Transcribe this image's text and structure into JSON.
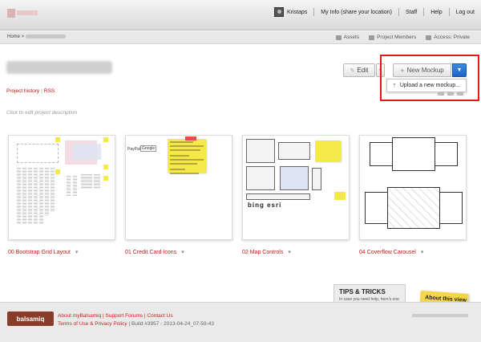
{
  "topbar": {
    "user": "Kristaps",
    "myinfo": "My Info (share your location)",
    "staff": "Staff",
    "help": "Help",
    "logout": "Log out"
  },
  "crumb": {
    "home": "Home >"
  },
  "meta": {
    "assets": "Assets",
    "members": "Project Members",
    "access": "Access: Private"
  },
  "project": {
    "history": "Project history",
    "rss": "RSS",
    "description_placeholder": "Click to edit project description"
  },
  "toolbar": {
    "edit": "Edit",
    "new_mockup": "New Mockup",
    "upload": "Upload a new mockup..."
  },
  "mockups": [
    {
      "label": "00 Bootstrap Grid Layout"
    },
    {
      "label": "01 Credit Card Icons"
    },
    {
      "label": "02 Map Controls"
    },
    {
      "label": "04 Coverflow Carousel"
    }
  ],
  "tips": {
    "title": "TIPS & TRICKS",
    "sub": "In case you need help, here's one",
    "note": "About this view"
  },
  "footer": {
    "logo": "balsamiq",
    "about": "About myBalsamiq",
    "forums": "Support Forums",
    "contact": "Contact Us",
    "terms": "Terms of Use & Privacy Policy",
    "build": "Build #3957 - 2013-04-24_07-59-43"
  },
  "colors": {
    "accent_red": "#c01818",
    "button_blue": "#1f63c3",
    "highlight": "#e31818",
    "footer_logo": "#8a3c2b"
  }
}
